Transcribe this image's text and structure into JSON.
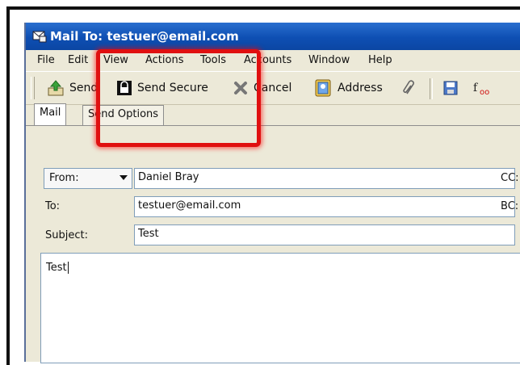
{
  "window": {
    "title": "Mail To: testuer@email.com"
  },
  "menubar": {
    "items": [
      "File",
      "Edit",
      "View",
      "Actions",
      "Tools",
      "Accounts",
      "Window",
      "Help"
    ]
  },
  "toolbar": {
    "send_label": "Send",
    "send_secure_label": "Send Secure",
    "cancel_label": "Cancel",
    "address_label": "Address"
  },
  "tabs": {
    "mail": "Mail",
    "send_options": "Send Options"
  },
  "form": {
    "from_label": "From:",
    "from_value": "Daniel Bray",
    "to_label": "To:",
    "to_value": "testuer@email.com",
    "subject_label": "Subject:",
    "subject_value": "Test",
    "cc_label": "CC:",
    "bc_label": "BC:",
    "body_text": "Test"
  },
  "colors": {
    "titlebar": "#0e4fb3",
    "highlight": "#e01010",
    "window_bg": "#ece9d8"
  }
}
